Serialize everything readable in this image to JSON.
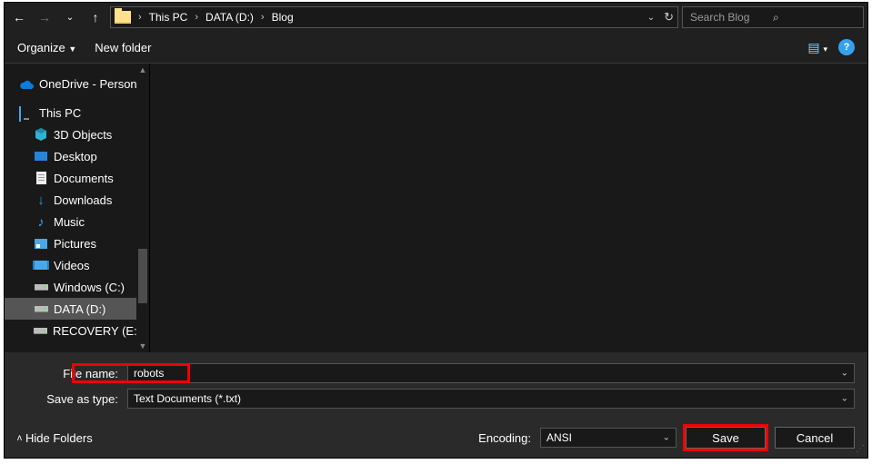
{
  "nav": {
    "breadcrumbs": [
      "This PC",
      "DATA (D:)",
      "Blog"
    ],
    "refresh": "↻"
  },
  "search": {
    "placeholder": "Search Blog"
  },
  "toolbar": {
    "organize": "Organize",
    "new_folder": "New folder"
  },
  "tree": {
    "onedrive": "OneDrive - Person",
    "this_pc": "This PC",
    "objects3d": "3D Objects",
    "desktop": "Desktop",
    "documents": "Documents",
    "downloads": "Downloads",
    "music": "Music",
    "pictures": "Pictures",
    "videos": "Videos",
    "windows_c": "Windows (C:)",
    "data_d": "DATA (D:)",
    "recovery_e": "RECOVERY (E:)"
  },
  "form": {
    "file_name_label": "File name:",
    "file_name_value": "robots",
    "save_type_label": "Save as type:",
    "save_type_value": "Text Documents (*.txt)"
  },
  "footer": {
    "hide_folders": "Hide Folders",
    "encoding_label": "Encoding:",
    "encoding_value": "ANSI",
    "save": "Save",
    "cancel": "Cancel"
  }
}
